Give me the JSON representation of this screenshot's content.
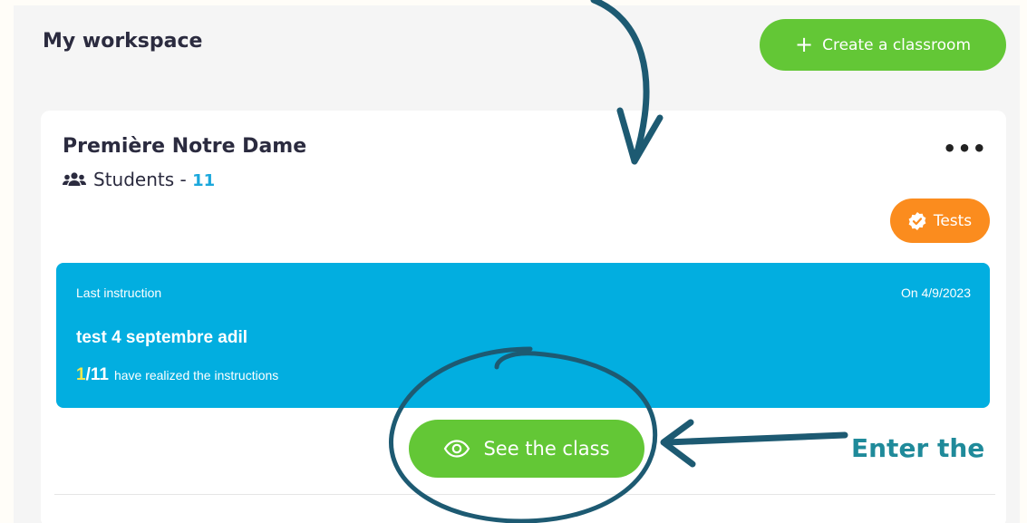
{
  "workspace": {
    "title": "My workspace",
    "create_button": {
      "icon": "plus-icon",
      "label": "Create a classroom"
    }
  },
  "classroom": {
    "name": "Première Notre Dame",
    "students_icon": "users-icon",
    "students_label": "Students - ",
    "students_count": "11",
    "menu_icon": "more-options-icon",
    "tests_button": {
      "icon": "badge-check-icon",
      "label": "Tests"
    },
    "last_instruction": {
      "label": "Last instruction",
      "date": "On 4/9/2023",
      "title": "test 4 septembre adil",
      "done": "1",
      "total": "/11",
      "progress_text": "have realized the instructions"
    },
    "see_button": {
      "icon": "eye-icon",
      "label": "See the class"
    }
  },
  "annotation": {
    "callout_text": "Enter the",
    "color": "#1d5a72"
  },
  "colors": {
    "green": "#63c736",
    "orange": "#fb8c1e",
    "blue": "#02aee0",
    "count_blue": "#1ba8dc"
  }
}
